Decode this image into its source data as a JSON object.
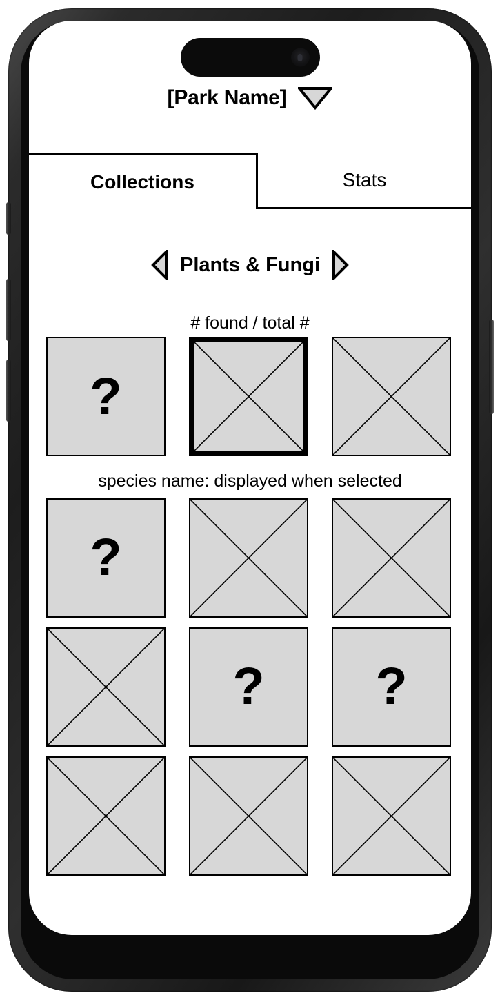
{
  "device": {
    "type": "smartphone-mockup",
    "island_name": "dynamic-island",
    "buttons": [
      "mute-switch",
      "volume-up",
      "volume-down",
      "power"
    ]
  },
  "header": {
    "park_name": "[Park Name]",
    "dropdown_icon": "chevron-down-triangle-icon"
  },
  "tabs": [
    {
      "id": "collections",
      "label": "Collections",
      "active": true
    },
    {
      "id": "stats",
      "label": "Stats",
      "active": false
    }
  ],
  "category_nav": {
    "prev_icon": "triangle-left-icon",
    "next_icon": "triangle-right-icon",
    "current_category": "Plants & Fungi",
    "count_label": "# found / total #"
  },
  "selection": {
    "species_name_label": "species name: displayed when selected",
    "selected_row": 0,
    "selected_col": 1
  },
  "grid": {
    "rows": [
      [
        {
          "state": "unknown",
          "icon": "question-mark-icon",
          "selected": false
        },
        {
          "state": "placeholder",
          "icon": "x-box-icon",
          "selected": true
        },
        {
          "state": "placeholder",
          "icon": "x-box-icon",
          "selected": false
        }
      ],
      [
        {
          "state": "unknown",
          "icon": "question-mark-icon",
          "selected": false
        },
        {
          "state": "placeholder",
          "icon": "x-box-icon",
          "selected": false
        },
        {
          "state": "placeholder",
          "icon": "x-box-icon",
          "selected": false
        }
      ],
      [
        {
          "state": "placeholder",
          "icon": "x-box-icon",
          "selected": false
        },
        {
          "state": "unknown",
          "icon": "question-mark-icon",
          "selected": false
        },
        {
          "state": "unknown",
          "icon": "question-mark-icon",
          "selected": false
        }
      ],
      [
        {
          "state": "placeholder",
          "icon": "x-box-icon",
          "selected": false
        },
        {
          "state": "placeholder",
          "icon": "x-box-icon",
          "selected": false
        },
        {
          "state": "placeholder",
          "icon": "x-box-icon",
          "selected": false
        }
      ]
    ],
    "question_glyph": "?"
  },
  "colors": {
    "tile_fill": "#d7d7d7",
    "tile_border": "#000000",
    "arrow_fill": "#d7d7d7",
    "screen_bg": "#ffffff",
    "text": "#000000"
  }
}
